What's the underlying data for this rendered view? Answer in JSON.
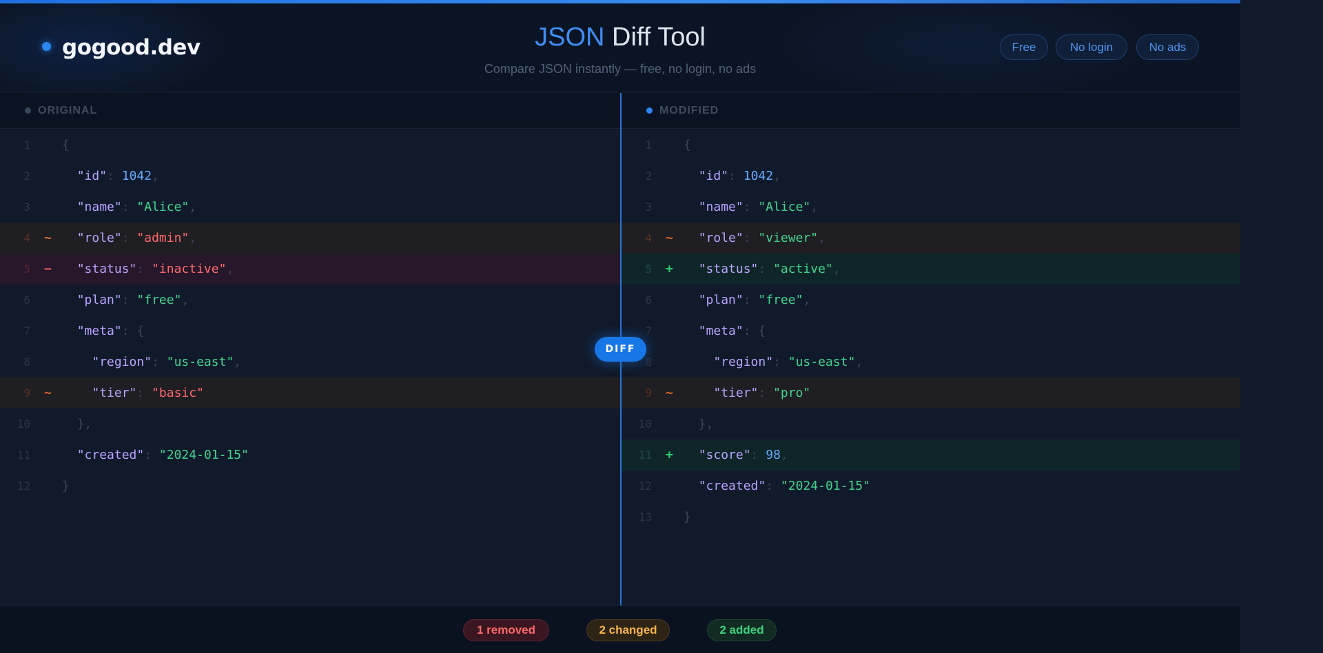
{
  "brand": {
    "name": "gogood.dev"
  },
  "header": {
    "title_accent": "JSON",
    "title_rest": " Diff Tool",
    "subtitle": "Compare JSON instantly — free, no login, no ads",
    "badges": [
      "Free",
      "No login",
      "No ads"
    ]
  },
  "colors": {
    "accent": "#3f8ef2",
    "removed": "#ff6a6a",
    "changed": "#e06a2a",
    "added": "#2ecc71"
  },
  "left": {
    "label": "ORIGINAL",
    "lines": [
      {
        "n": "1",
        "mark": "",
        "state": "",
        "code": [
          [
            "p",
            "{"
          ]
        ]
      },
      {
        "n": "2",
        "mark": "",
        "state": "",
        "code": [
          [
            "p",
            "  "
          ],
          [
            "k",
            "\"id\""
          ],
          [
            "p",
            ": "
          ],
          [
            "n",
            "1042"
          ],
          [
            "p",
            ","
          ]
        ]
      },
      {
        "n": "3",
        "mark": "",
        "state": "",
        "code": [
          [
            "p",
            "  "
          ],
          [
            "k",
            "\"name\""
          ],
          [
            "p",
            ": "
          ],
          [
            "s",
            "\"Alice\""
          ],
          [
            "p",
            ","
          ]
        ]
      },
      {
        "n": "4",
        "mark": "~",
        "state": "changed",
        "code": [
          [
            "p",
            "  "
          ],
          [
            "k",
            "\"role\""
          ],
          [
            "p",
            ": "
          ],
          [
            "d",
            "\"admin\""
          ],
          [
            "p",
            ","
          ]
        ]
      },
      {
        "n": "5",
        "mark": "−",
        "state": "removed",
        "code": [
          [
            "p",
            "  "
          ],
          [
            "k",
            "\"status\""
          ],
          [
            "p",
            ": "
          ],
          [
            "d",
            "\"inactive\""
          ],
          [
            "p",
            ","
          ]
        ]
      },
      {
        "n": "6",
        "mark": "",
        "state": "",
        "code": [
          [
            "p",
            "  "
          ],
          [
            "k",
            "\"plan\""
          ],
          [
            "p",
            ": "
          ],
          [
            "s",
            "\"free\""
          ],
          [
            "p",
            ","
          ]
        ]
      },
      {
        "n": "7",
        "mark": "",
        "state": "",
        "code": [
          [
            "p",
            "  "
          ],
          [
            "k",
            "\"meta\""
          ],
          [
            "p",
            ": {"
          ]
        ]
      },
      {
        "n": "8",
        "mark": "",
        "state": "",
        "code": [
          [
            "p",
            "    "
          ],
          [
            "k",
            "\"region\""
          ],
          [
            "p",
            ": "
          ],
          [
            "s",
            "\"us-east\""
          ],
          [
            "p",
            ","
          ]
        ]
      },
      {
        "n": "9",
        "mark": "~",
        "state": "changed",
        "code": [
          [
            "p",
            "    "
          ],
          [
            "k",
            "\"tier\""
          ],
          [
            "p",
            ": "
          ],
          [
            "d",
            "\"basic\""
          ]
        ]
      },
      {
        "n": "10",
        "mark": "",
        "state": "",
        "code": [
          [
            "p",
            "  },"
          ]
        ]
      },
      {
        "n": "11",
        "mark": "",
        "state": "",
        "code": [
          [
            "p",
            "  "
          ],
          [
            "k",
            "\"created\""
          ],
          [
            "p",
            ": "
          ],
          [
            "s",
            "\"2024-01-15\""
          ]
        ]
      },
      {
        "n": "12",
        "mark": "",
        "state": "",
        "code": [
          [
            "p",
            "}"
          ]
        ]
      }
    ]
  },
  "right": {
    "label": "MODIFIED",
    "lines": [
      {
        "n": "1",
        "mark": "",
        "state": "",
        "code": [
          [
            "p",
            "{"
          ]
        ]
      },
      {
        "n": "2",
        "mark": "",
        "state": "",
        "code": [
          [
            "p",
            "  "
          ],
          [
            "k",
            "\"id\""
          ],
          [
            "p",
            ": "
          ],
          [
            "n",
            "1042"
          ],
          [
            "p",
            ","
          ]
        ]
      },
      {
        "n": "3",
        "mark": "",
        "state": "",
        "code": [
          [
            "p",
            "  "
          ],
          [
            "k",
            "\"name\""
          ],
          [
            "p",
            ": "
          ],
          [
            "s",
            "\"Alice\""
          ],
          [
            "p",
            ","
          ]
        ]
      },
      {
        "n": "4",
        "mark": "~",
        "state": "changed",
        "code": [
          [
            "p",
            "  "
          ],
          [
            "k",
            "\"role\""
          ],
          [
            "p",
            ": "
          ],
          [
            "s",
            "\"viewer\""
          ],
          [
            "p",
            ","
          ]
        ]
      },
      {
        "n": "5",
        "mark": "+",
        "state": "added",
        "code": [
          [
            "p",
            "  "
          ],
          [
            "k",
            "\"status\""
          ],
          [
            "p",
            ": "
          ],
          [
            "s",
            "\"active\""
          ],
          [
            "p",
            ","
          ]
        ]
      },
      {
        "n": "6",
        "mark": "",
        "state": "",
        "code": [
          [
            "p",
            "  "
          ],
          [
            "k",
            "\"plan\""
          ],
          [
            "p",
            ": "
          ],
          [
            "s",
            "\"free\""
          ],
          [
            "p",
            ","
          ]
        ]
      },
      {
        "n": "7",
        "mark": "",
        "state": "",
        "code": [
          [
            "p",
            "  "
          ],
          [
            "k",
            "\"meta\""
          ],
          [
            "p",
            ": {"
          ]
        ]
      },
      {
        "n": "8",
        "mark": "",
        "state": "",
        "code": [
          [
            "p",
            "    "
          ],
          [
            "k",
            "\"region\""
          ],
          [
            "p",
            ": "
          ],
          [
            "s",
            "\"us-east\""
          ],
          [
            "p",
            ","
          ]
        ]
      },
      {
        "n": "9",
        "mark": "~",
        "state": "changed",
        "code": [
          [
            "p",
            "    "
          ],
          [
            "k",
            "\"tier\""
          ],
          [
            "p",
            ": "
          ],
          [
            "s",
            "\"pro\""
          ]
        ]
      },
      {
        "n": "10",
        "mark": "",
        "state": "",
        "code": [
          [
            "p",
            "  },"
          ]
        ]
      },
      {
        "n": "11",
        "mark": "+",
        "state": "added",
        "code": [
          [
            "p",
            "  "
          ],
          [
            "k",
            "\"score\""
          ],
          [
            "p",
            ": "
          ],
          [
            "n",
            "98"
          ],
          [
            "p",
            ","
          ]
        ]
      },
      {
        "n": "12",
        "mark": "",
        "state": "",
        "code": [
          [
            "p",
            "  "
          ],
          [
            "k",
            "\"created\""
          ],
          [
            "p",
            ": "
          ],
          [
            "s",
            "\"2024-01-15\""
          ]
        ]
      },
      {
        "n": "13",
        "mark": "",
        "state": "",
        "code": [
          [
            "p",
            "}"
          ]
        ]
      }
    ]
  },
  "divider": {
    "label": "DIFF"
  },
  "footer": {
    "removed": "1 removed",
    "changed": "2 changed",
    "added": "2 added"
  }
}
